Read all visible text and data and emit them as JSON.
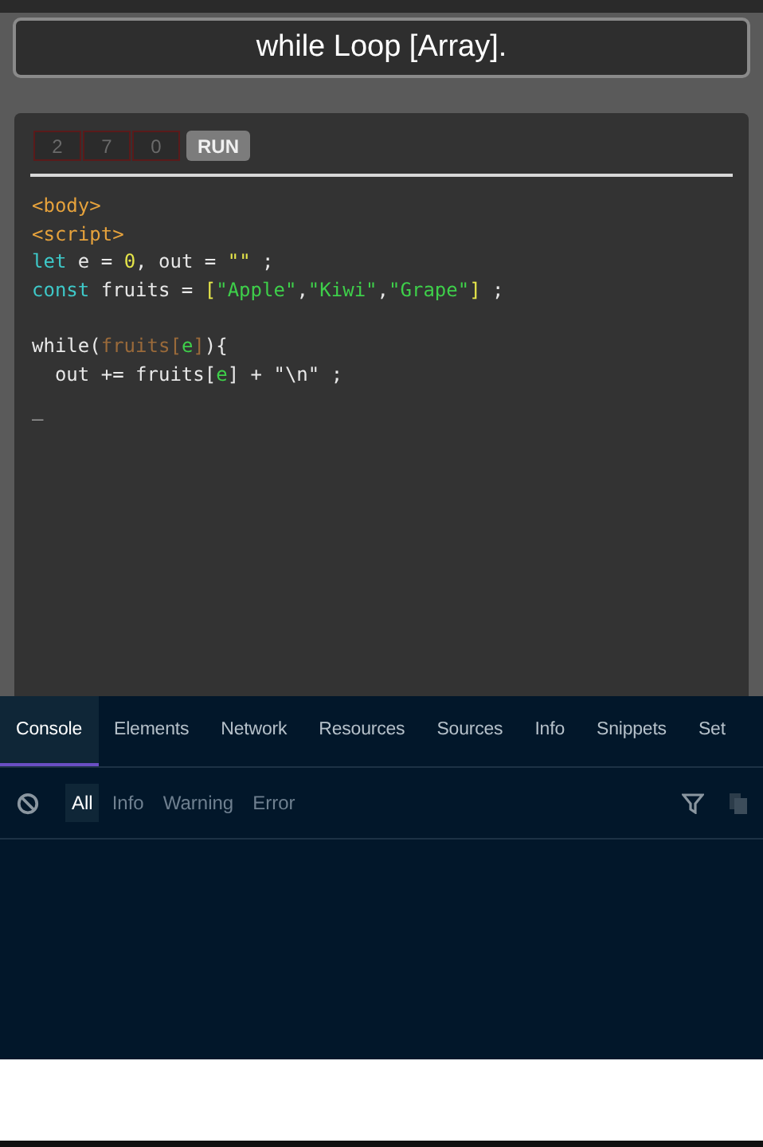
{
  "title": "while Loop [Array].",
  "counters": [
    "2",
    "7",
    "0"
  ],
  "run_button": "RUN",
  "code_lines": [
    [
      {
        "kind": "tag",
        "text": "<body>"
      }
    ],
    [
      {
        "kind": "tag",
        "text": "<script>"
      }
    ],
    [
      {
        "kind": "keyword",
        "text": "let"
      },
      {
        "kind": "plain",
        "text": " e = "
      },
      {
        "kind": "number",
        "text": "0"
      },
      {
        "kind": "plain",
        "text": ", out = "
      },
      {
        "kind": "string",
        "text": "\"\""
      },
      {
        "kind": "plain",
        "text": " ;"
      }
    ],
    [
      {
        "kind": "keyword",
        "text": "const"
      },
      {
        "kind": "plain",
        "text": " fruits = "
      },
      {
        "kind": "bracket",
        "text": "["
      },
      {
        "kind": "green",
        "text": "\"Apple\""
      },
      {
        "kind": "plain",
        "text": ","
      },
      {
        "kind": "green",
        "text": "\"Kiwi\""
      },
      {
        "kind": "plain",
        "text": ","
      },
      {
        "kind": "green",
        "text": "\"Grape\""
      },
      {
        "kind": "bracket",
        "text": "]"
      },
      {
        "kind": "plain",
        "text": " ;"
      }
    ],
    [
      {
        "kind": "blank"
      }
    ],
    [
      {
        "kind": "plain",
        "text": "while("
      },
      {
        "kind": "dim",
        "text": "fruits["
      },
      {
        "kind": "green",
        "text": "e"
      },
      {
        "kind": "dim",
        "text": "]"
      },
      {
        "kind": "plain",
        "text": "){"
      }
    ],
    [
      {
        "kind": "plain",
        "text": "  out += fruits["
      },
      {
        "kind": "green",
        "text": "e"
      },
      {
        "kind": "plain",
        "text": "] + \"\\n\" ;"
      }
    ],
    [
      {
        "kind": "cursor",
        "text": "_"
      }
    ]
  ],
  "devtools": {
    "tabs": [
      {
        "label": "Console",
        "selected": true
      },
      {
        "label": "Elements",
        "selected": false
      },
      {
        "label": "Network",
        "selected": false
      },
      {
        "label": "Resources",
        "selected": false
      },
      {
        "label": "Sources",
        "selected": false
      },
      {
        "label": "Info",
        "selected": false
      },
      {
        "label": "Snippets",
        "selected": false
      },
      {
        "label": "Set",
        "selected": false
      }
    ],
    "filters": [
      {
        "label": "All",
        "selected": true
      },
      {
        "label": "Info",
        "selected": false
      },
      {
        "label": "Warning",
        "selected": false
      },
      {
        "label": "Error",
        "selected": false
      }
    ]
  }
}
